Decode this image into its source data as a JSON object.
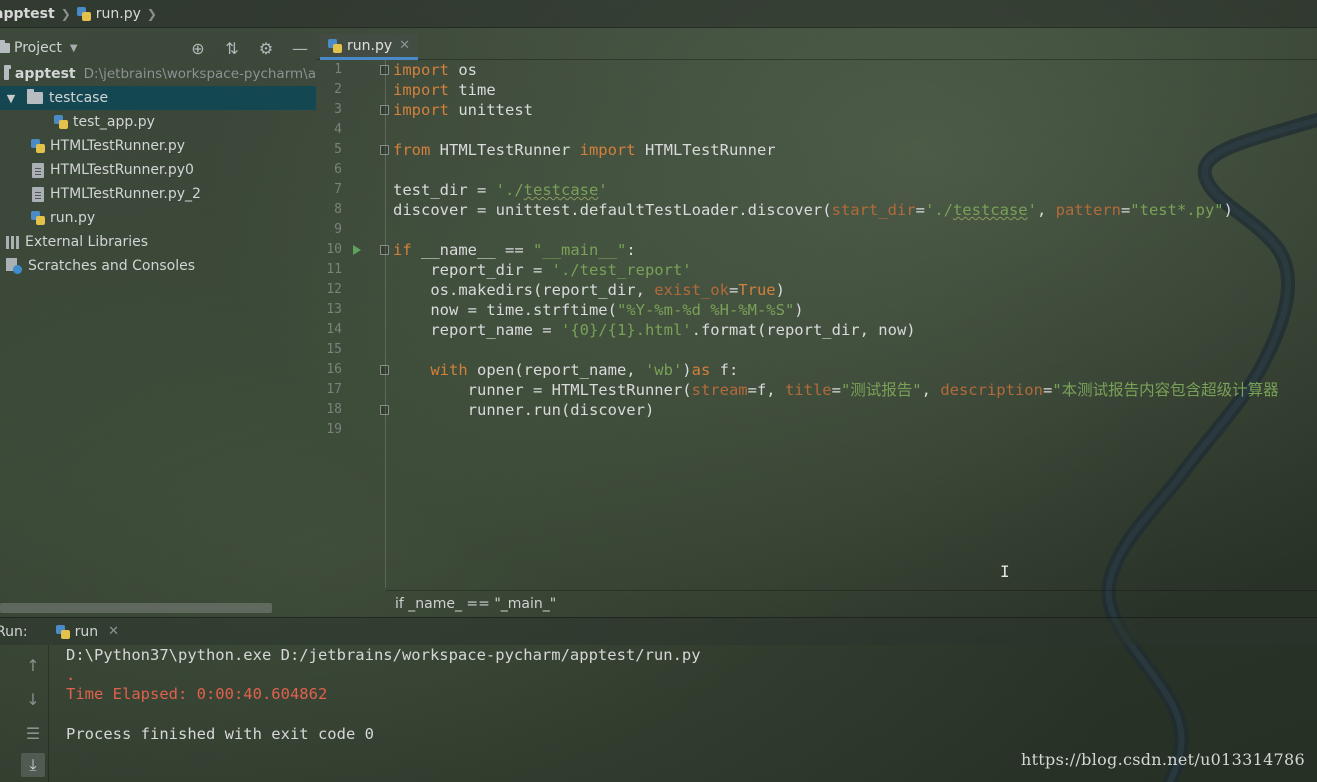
{
  "breadcrumb": {
    "project": "apptest",
    "file": "run.py"
  },
  "project_panel": {
    "title": "Project",
    "icons": [
      "crosshair-icon",
      "collapse-icon",
      "gear-icon",
      "minimize-icon"
    ],
    "tree": [
      {
        "label": "apptest",
        "path": "D:\\jetbrains\\workspace-pycharm\\a",
        "type": "folder",
        "bold": true
      },
      {
        "label": "testcase",
        "type": "folder",
        "expanded": true,
        "selected": true
      },
      {
        "label": "test_app.py",
        "type": "python"
      },
      {
        "label": "HTMLTestRunner.py",
        "type": "python"
      },
      {
        "label": "HTMLTestRunner.py0",
        "type": "text"
      },
      {
        "label": "HTMLTestRunner.py_2",
        "type": "text"
      },
      {
        "label": "run.py",
        "type": "python"
      },
      {
        "label": "External Libraries",
        "type": "library"
      },
      {
        "label": "Scratches and Consoles",
        "type": "scratch"
      }
    ]
  },
  "editor": {
    "tab": "run.py",
    "line_numbers": [
      "1",
      "2",
      "3",
      "4",
      "5",
      "6",
      "7",
      "8",
      "9",
      "10",
      "11",
      "12",
      "13",
      "14",
      "15",
      "16",
      "17",
      "18",
      "19"
    ],
    "code": {
      "l1_kw": "import",
      "l1_rest": " os",
      "l2_kw": "import",
      "l2_rest": " time",
      "l3_kw": "import",
      "l3_rest": " unittest",
      "l5_kw1": "from",
      "l5_mid": " HTMLTestRunner ",
      "l5_kw2": "import",
      "l5_rest": " HTMLTestRunner",
      "l7_a": "test_dir = ",
      "l7_s1": "'./",
      "l7_s2": "testcase",
      "l7_s3": "'",
      "l8_a": "discover = unittest.defaultTestLoader.discover(",
      "l8_p1": "start_dir",
      "l8_b": "=",
      "l8_s1": "'./",
      "l8_s2": "testcase",
      "l8_s3": "'",
      "l8_c": ", ",
      "l8_p2": "pattern",
      "l8_d": "=",
      "l8_s4": "\"test*.py\"",
      "l8_e": ")",
      "l10_kw": "if",
      "l10_a": " __name__ == ",
      "l10_s": "\"__main__\"",
      "l10_b": ":",
      "l11_a": "    report_dir = ",
      "l11_s": "'./test_report'",
      "l12_a": "    os.makedirs(report_dir, ",
      "l12_p": "exist_ok",
      "l12_b": "=",
      "l12_k": "True",
      "l12_c": ")",
      "l13_a": "    now = time.strftime(",
      "l13_s": "\"%Y-%m-%d %H-%M-%S\"",
      "l13_b": ")",
      "l14_a": "    report_name = ",
      "l14_s": "'{0}/{1}.html'",
      "l14_b": ".format(report_dir, now)",
      "l16_pre": "    ",
      "l16_kw": "with",
      "l16_a": " open(report_name, ",
      "l16_s": "'wb'",
      "l16_b": ")",
      "l16_kw2": "as",
      "l16_c": " f:",
      "l17_a": "        runner = HTMLTestRunner(",
      "l17_p1": "stream",
      "l17_b": "=f, ",
      "l17_p2": "title",
      "l17_c": "=",
      "l17_s1": "\"测试报告\"",
      "l17_d": ", ",
      "l17_p3": "description",
      "l17_e": "=",
      "l17_s2": "\"本测试报告内容包含超级计算器",
      "l18_a": "        runner.run(discover)"
    },
    "footer_crumb": "if _name_ == \"_main_\""
  },
  "run_panel": {
    "label": "Run:",
    "tab": "run",
    "console": [
      {
        "text": "D:\\Python37\\python.exe D:/jetbrains/workspace-pycharm/apptest/run.py",
        "kind": "normal"
      },
      {
        "text": ".",
        "kind": "err"
      },
      {
        "text": "Time Elapsed: 0:00:40.604862",
        "kind": "err"
      },
      {
        "text": "",
        "kind": "normal"
      },
      {
        "text": "Process finished with exit code 0",
        "kind": "normal"
      }
    ],
    "toolbar_icons": [
      "up-arrow-icon",
      "down-arrow-icon",
      "soft-wrap-icon",
      "scroll-to-end-icon"
    ]
  },
  "watermark": "https://blog.csdn.net/u013314786",
  "colors": {
    "keyword": "#d3803a",
    "string": "#7aa158",
    "error": "#e0614c",
    "selection": "#0d4856",
    "tab_underline": "#4a88c7"
  }
}
